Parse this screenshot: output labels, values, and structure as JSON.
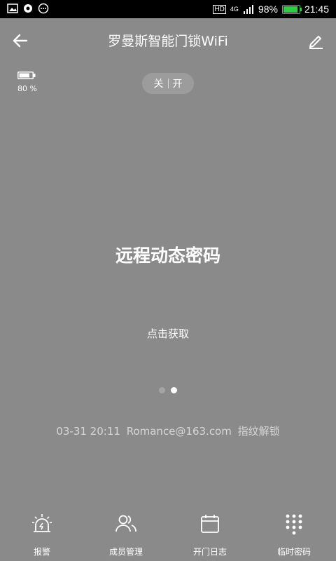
{
  "status_bar": {
    "battery_percent": "98%",
    "time": "21:45",
    "network": "4G",
    "hd_label": "HD"
  },
  "header": {
    "title": "罗曼斯智能门锁WiFi"
  },
  "device": {
    "battery_label": "80 %",
    "battery_level": 0.8
  },
  "toggle": {
    "off_label": "关",
    "on_label": "开"
  },
  "main": {
    "title": "远程动态密码",
    "action": "点击获取",
    "pager_total": 2,
    "pager_active": 1
  },
  "last_record": {
    "time": "03-31 20:11",
    "user": "Romance@163.com",
    "method": "指纹解锁"
  },
  "bottom_nav": {
    "items": [
      {
        "label": "报警",
        "icon": "alarm-icon"
      },
      {
        "label": "成员管理",
        "icon": "members-icon"
      },
      {
        "label": "开门日志",
        "icon": "calendar-icon"
      },
      {
        "label": "临时密码",
        "icon": "keypad-icon"
      }
    ]
  },
  "colors": {
    "background": "#8a8a8a",
    "status_bar": "#000000",
    "battery_green": "#2ecc40",
    "text": "#ffffff"
  }
}
